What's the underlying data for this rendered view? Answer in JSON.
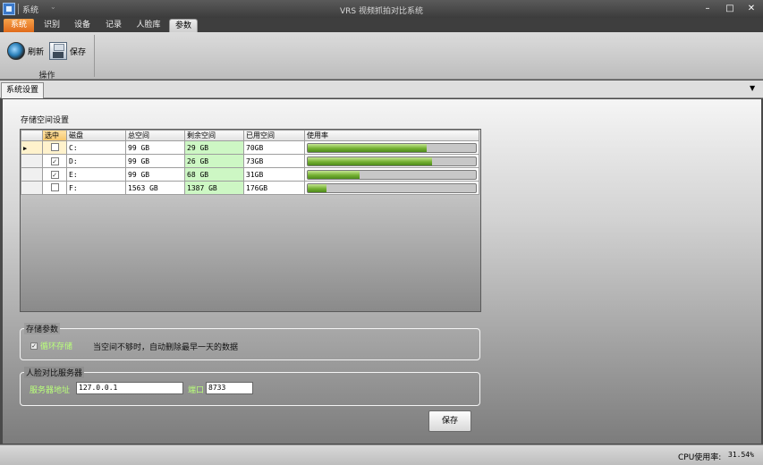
{
  "window": {
    "title": "VRS 视频抓拍对比系统",
    "qat_label": "系统",
    "qat_arrow": "⌄",
    "minimize": "–",
    "maximize": "□",
    "close": "✕"
  },
  "ribbon_tabs": [
    "系统",
    "识别",
    "设备",
    "记录",
    "人脸库",
    "参数"
  ],
  "active_tab": "参数",
  "ribbon": {
    "refresh_label": "刷新",
    "save_label": "保存",
    "group_label": "操作"
  },
  "doc_tab": "系统设置",
  "storage": {
    "section_title": "存储空间设置",
    "columns": [
      "选中",
      "磁盘",
      "总空间",
      "剩余空间",
      "已用空间",
      "使用率"
    ],
    "rows": [
      {
        "checked": false,
        "disk": "C:",
        "total": "99 GB",
        "free": "29 GB",
        "used": "70GB",
        "usage": 0.71,
        "current": true
      },
      {
        "checked": true,
        "disk": "D:",
        "total": "99 GB",
        "free": "26 GB",
        "used": "73GB",
        "usage": 0.74,
        "current": false
      },
      {
        "checked": true,
        "disk": "E:",
        "total": "99 GB",
        "free": "68 GB",
        "used": "31GB",
        "usage": 0.31,
        "current": false
      },
      {
        "checked": false,
        "disk": "F:",
        "total": "1563 GB",
        "free": "1387 GB",
        "used": "176GB",
        "usage": 0.11,
        "current": false
      }
    ]
  },
  "storage_params": {
    "legend": "存储参数",
    "loop_label": "循环存储",
    "loop_checked": true,
    "hint": "当空间不够时，自动删除最早一天的数据"
  },
  "face_server": {
    "legend": "人脸对比服务器",
    "address_label": "服务器地址",
    "address_value": "127.0.0.1",
    "port_label": "端口",
    "port_value": "8733"
  },
  "save_button": "保存",
  "status": {
    "cpu_label": "CPU使用率:",
    "cpu_value": "31.54%"
  },
  "colors": {
    "active_tab_orange": "#f08a2c",
    "free_space_green": "#cdf7c4",
    "usage_bar_green": "#74b032",
    "label_green": "#b9ff7a"
  }
}
